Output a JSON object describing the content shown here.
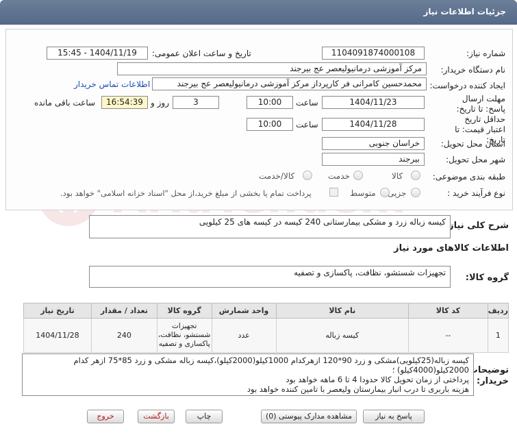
{
  "title": "جزئیات اطلاعات نیاز",
  "fields": {
    "need_number_label": "شماره نیاز:",
    "need_number": "1104091874000108",
    "announce_label": "تاریخ و ساعت اعلان عمومی:",
    "announce_value": "1404/11/19 - 15:45",
    "buyer_org_label": "نام دستگاه خریدار:",
    "buyer_org": "مرکز آموزشی درمانیولیعصر  عج  بیرجند",
    "requester_label": "ایجاد کننده درخواست:",
    "requester": "محمدحسین کامرانی فر کارپرداز مرکز آموزشی درمانیولیعصر  عج  بیرجند",
    "contact_link": "اطلاعات تماس خریدار",
    "deadline_label": "مهلت ارسال پاسخ: تا تاریخ:",
    "deadline_date": "1404/11/23",
    "time_label": "ساعت",
    "deadline_time": "10:00",
    "days_value": "3",
    "days_label": "روز و",
    "remaining_time": "16:54:39",
    "remaining_label": "ساعت باقی مانده",
    "validity_label": "حداقل تاریخ اعتبار قیمت: تا تاریخ:",
    "validity_date": "1404/11/28",
    "validity_time": "10:00",
    "province_label": "استان محل تحویل:",
    "province": "خراسان جنوبی",
    "city_label": "شهر محل تحویل:",
    "city": "بیرجند",
    "category_label": "طبقه بندی موضوعی:",
    "category_options": [
      "کالا",
      "خدمت",
      "کالا/خدمت"
    ],
    "process_label": "نوع فرآیند خرید :",
    "process_options": [
      "جزیی",
      "متوسط"
    ],
    "payment_note": "پرداخت تمام یا بخشی از مبلغ خرید،از محل \"اسناد خزانه اسلامی\" خواهد بود."
  },
  "general_desc_label": "شرح کلی نیاز:",
  "general_desc": "کیسه زباله زرد و مشکی بیمارستانی 240 کیسه در کیسه های 25 کیلویی",
  "goods_info_title": "اطلاعات کالاهای مورد نیاز",
  "goods_group_label": "گروه کالا:",
  "goods_group": "تجهیزات شستشو، نظافت، پاکسازی و تصفیه",
  "table": {
    "headers": [
      "ردیف",
      "کد کالا",
      "نام کالا",
      "واحد شمارش",
      "تعداد / مقدار",
      "تاریخ نیاز"
    ],
    "group_header": "گروه کالا",
    "rows": [
      {
        "row": "1",
        "code": "--",
        "name": "کیسه زباله",
        "unit": "عدد",
        "qty": "240",
        "date": "1404/11/28",
        "group_lines": [
          "تجهیزات",
          "شستشو، نظافت،",
          "پاکسازی و تصفیه"
        ]
      }
    ]
  },
  "buyer_notes_label": "توضیحات خریدار:",
  "buyer_notes": [
    "کیسه زباله(25کیلویی)مشکی و زرد 90*120 ازهرکدام 1000کیلو(2000کیلو)،کیسه زباله مشکی و زرد 85*75 ازهر کدام",
    "2000کیلو(4000کیلو) ؛",
    "پرداختی از زمان تحویل کالا حدودا 4 تا 6 ماهه خواهد بود",
    "هزینه باربری تا درب انبار بیمارستان ولیعصر با تامین کننده خواهد بود"
  ],
  "buttons": {
    "reply": "پاسخ به نیاز",
    "attachments": "مشاهده مدارک پیوستی (0)",
    "print": "چاپ",
    "back": "بازگشت",
    "exit": "خروج"
  },
  "watermark_text": "AriaTender.neT",
  "colors": {
    "header": "#5d7090",
    "link": "#1a4fb5",
    "remaining_bg": "#fff7c8",
    "exit_text": "#b01818"
  }
}
